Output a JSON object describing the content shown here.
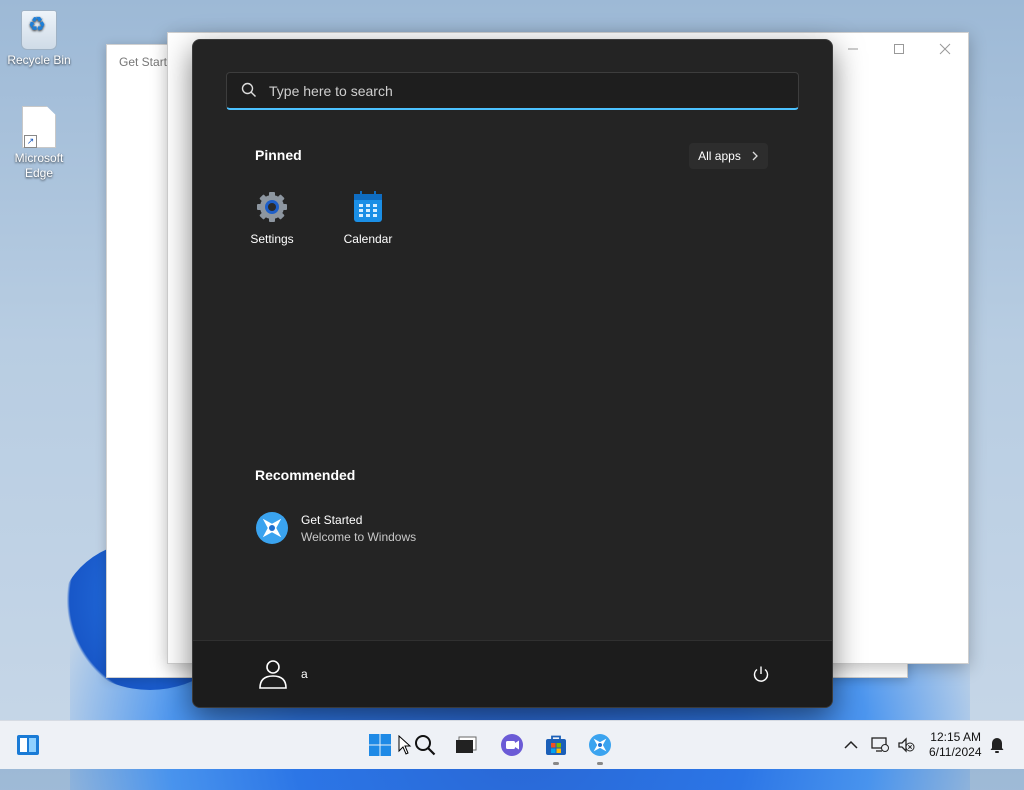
{
  "desktop": {
    "icons": [
      {
        "label": "Recycle Bin"
      },
      {
        "label": "Microsoft Edge"
      }
    ]
  },
  "background_window": {
    "title": "Get Started"
  },
  "start_menu": {
    "search": {
      "placeholder": "Type here to search"
    },
    "pinned": {
      "title": "Pinned",
      "all_apps_label": "All apps",
      "items": [
        {
          "label": "Settings",
          "icon": "settings-gear-icon"
        },
        {
          "label": "Calendar",
          "icon": "calendar-icon"
        }
      ]
    },
    "recommended": {
      "title": "Recommended",
      "items": [
        {
          "title": "Get Started",
          "subtitle": "Welcome to Windows",
          "icon": "get-started-icon"
        }
      ]
    },
    "user": {
      "name": "a"
    },
    "power_icon": "power-icon"
  },
  "taskbar": {
    "items": [
      "widgets-icon",
      "start-icon",
      "search-icon",
      "task-view-icon",
      "chat-icon",
      "store-icon",
      "get-started-icon"
    ],
    "clock": {
      "time": "12:15 AM",
      "date": "6/11/2024"
    }
  },
  "colors": {
    "accent": "#4cc2ff",
    "start_bg": "#242424",
    "taskbar_bg": "#eef1f6"
  }
}
